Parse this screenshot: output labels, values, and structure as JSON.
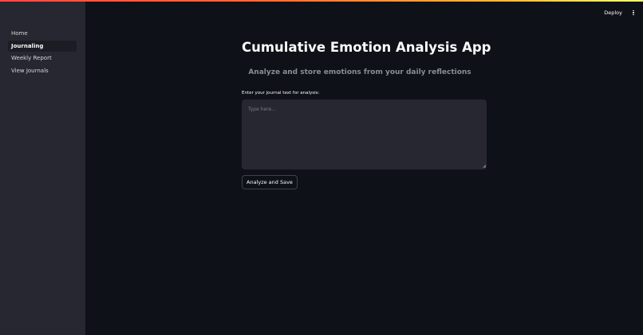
{
  "header": {
    "deploy_label": "Deploy",
    "menu_icon": "vertical-ellipsis-icon"
  },
  "sidebar": {
    "items": [
      {
        "label": "Home",
        "active": false
      },
      {
        "label": "Journaling",
        "active": true
      },
      {
        "label": "Weekly Report",
        "active": false
      },
      {
        "label": "View Journals",
        "active": false
      }
    ]
  },
  "main": {
    "title": "Cumulative Emotion Analysis App",
    "subtitle": "Analyze and store emotions from your daily reflections",
    "input_label": "Enter your journal text for analysis:",
    "input_value": "",
    "input_placeholder": "Type here...",
    "submit_label": "Analyze and Save"
  },
  "colors": {
    "background": "#0e1117",
    "sidebar": "#262730",
    "input_background": "#262730",
    "text": "#fafafa",
    "subtitle": "#8b8d95",
    "accent_gradient_start": "#ff4b4b",
    "accent_gradient_end": "#fffd80"
  }
}
